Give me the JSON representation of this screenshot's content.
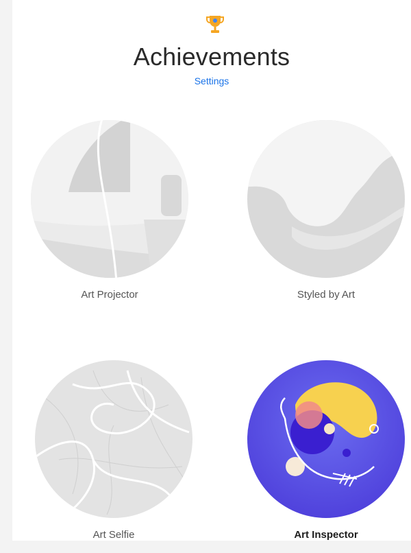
{
  "header": {
    "icon": "trophy-icon",
    "title": "Achievements",
    "settings_link": "Settings"
  },
  "achievements": [
    {
      "label": "Art Projector",
      "icon": "art-projector-badge-icon",
      "unlocked": false
    },
    {
      "label": "Styled by Art",
      "icon": "styled-by-art-badge-icon",
      "unlocked": false
    },
    {
      "label": "Art Selfie",
      "icon": "art-selfie-badge-icon",
      "unlocked": false
    },
    {
      "label": "Art Inspector",
      "icon": "art-inspector-badge-icon",
      "unlocked": true
    }
  ],
  "colors": {
    "accent": "#1a73e8",
    "trophy": "#f5a623",
    "locked": "#e4e4e4",
    "unlocked": "#5a52e6"
  }
}
